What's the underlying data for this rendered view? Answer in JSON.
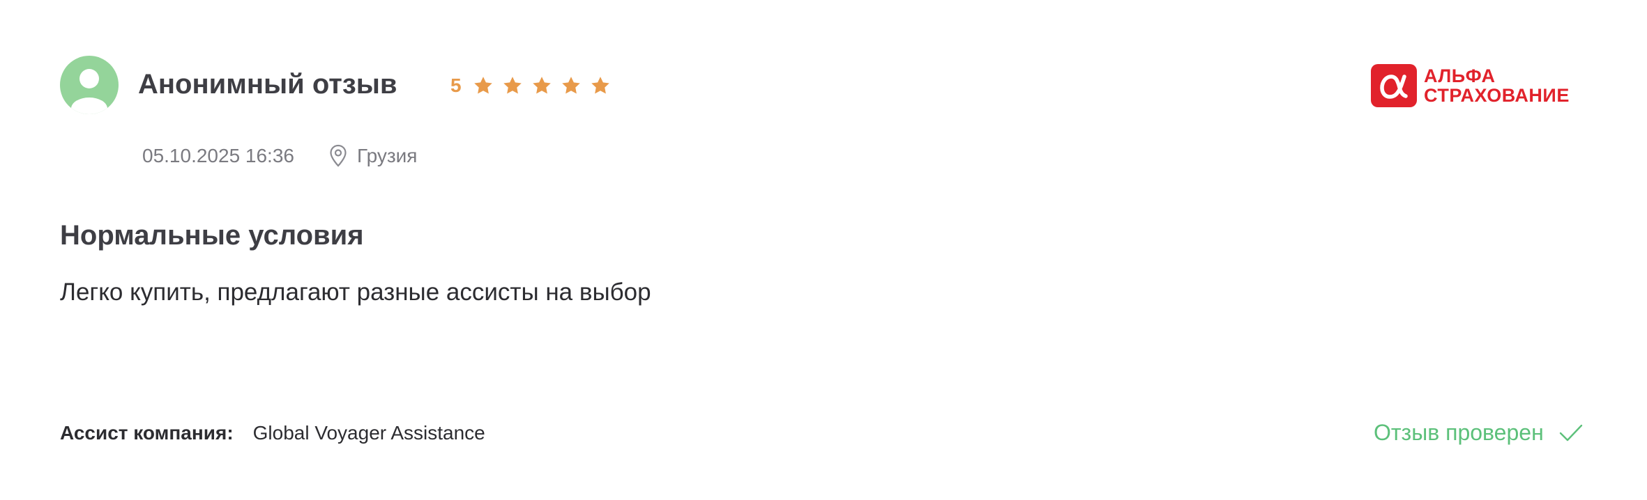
{
  "review": {
    "author": "Анонимный отзыв",
    "rating": "5",
    "stars_filled": 5,
    "stars_total": 5,
    "date": "05.10.2025 16:36",
    "location": "Грузия",
    "title": "Нормальные условия",
    "text": "Легко купить, предлагают разные ассисты на выбор"
  },
  "company": {
    "logo_line1": "АЛЬФА",
    "logo_line2": "СТРАХОВАНИЕ",
    "logo_icon": "alpha-logo-icon"
  },
  "assist": {
    "label": "Ассист компания:",
    "value": "Global Voyager Assistance"
  },
  "verification": {
    "label": "Отзыв проверен"
  },
  "colors": {
    "avatar_bg": "#94d49a",
    "star": "#e89a4a",
    "brand": "#e1222b",
    "verified": "#5cc07a"
  }
}
